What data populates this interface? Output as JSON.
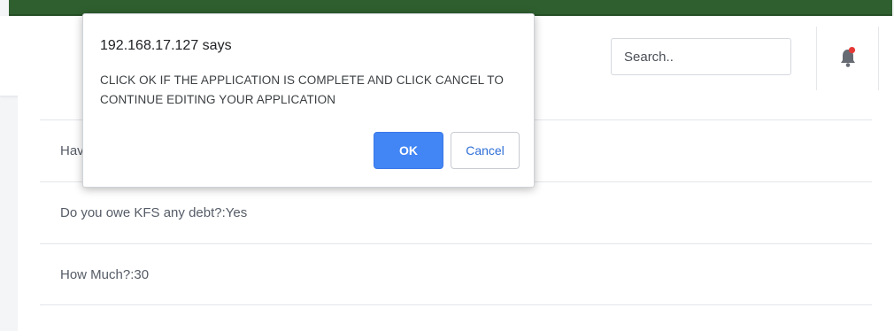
{
  "header": {
    "search": {
      "placeholder": "Search.."
    },
    "notification": {
      "icon": "bell-icon",
      "badge_color": "#e53935"
    }
  },
  "content": {
    "items": [
      {
        "label": "Hav"
      },
      {
        "label": "Do you owe KFS any debt?:Yes"
      },
      {
        "label": "How Much?:30"
      }
    ]
  },
  "dialog": {
    "title": "192.168.17.127 says",
    "message": "CLICK OK IF THE APPLICATION IS COMPLETE AND CLICK CANCEL TO CONTINUE EDITING YOUR APPLICATION",
    "ok_label": "OK",
    "cancel_label": "Cancel"
  },
  "colors": {
    "top_strip": "#2f5f2f",
    "primary_button": "#4285f4"
  }
}
